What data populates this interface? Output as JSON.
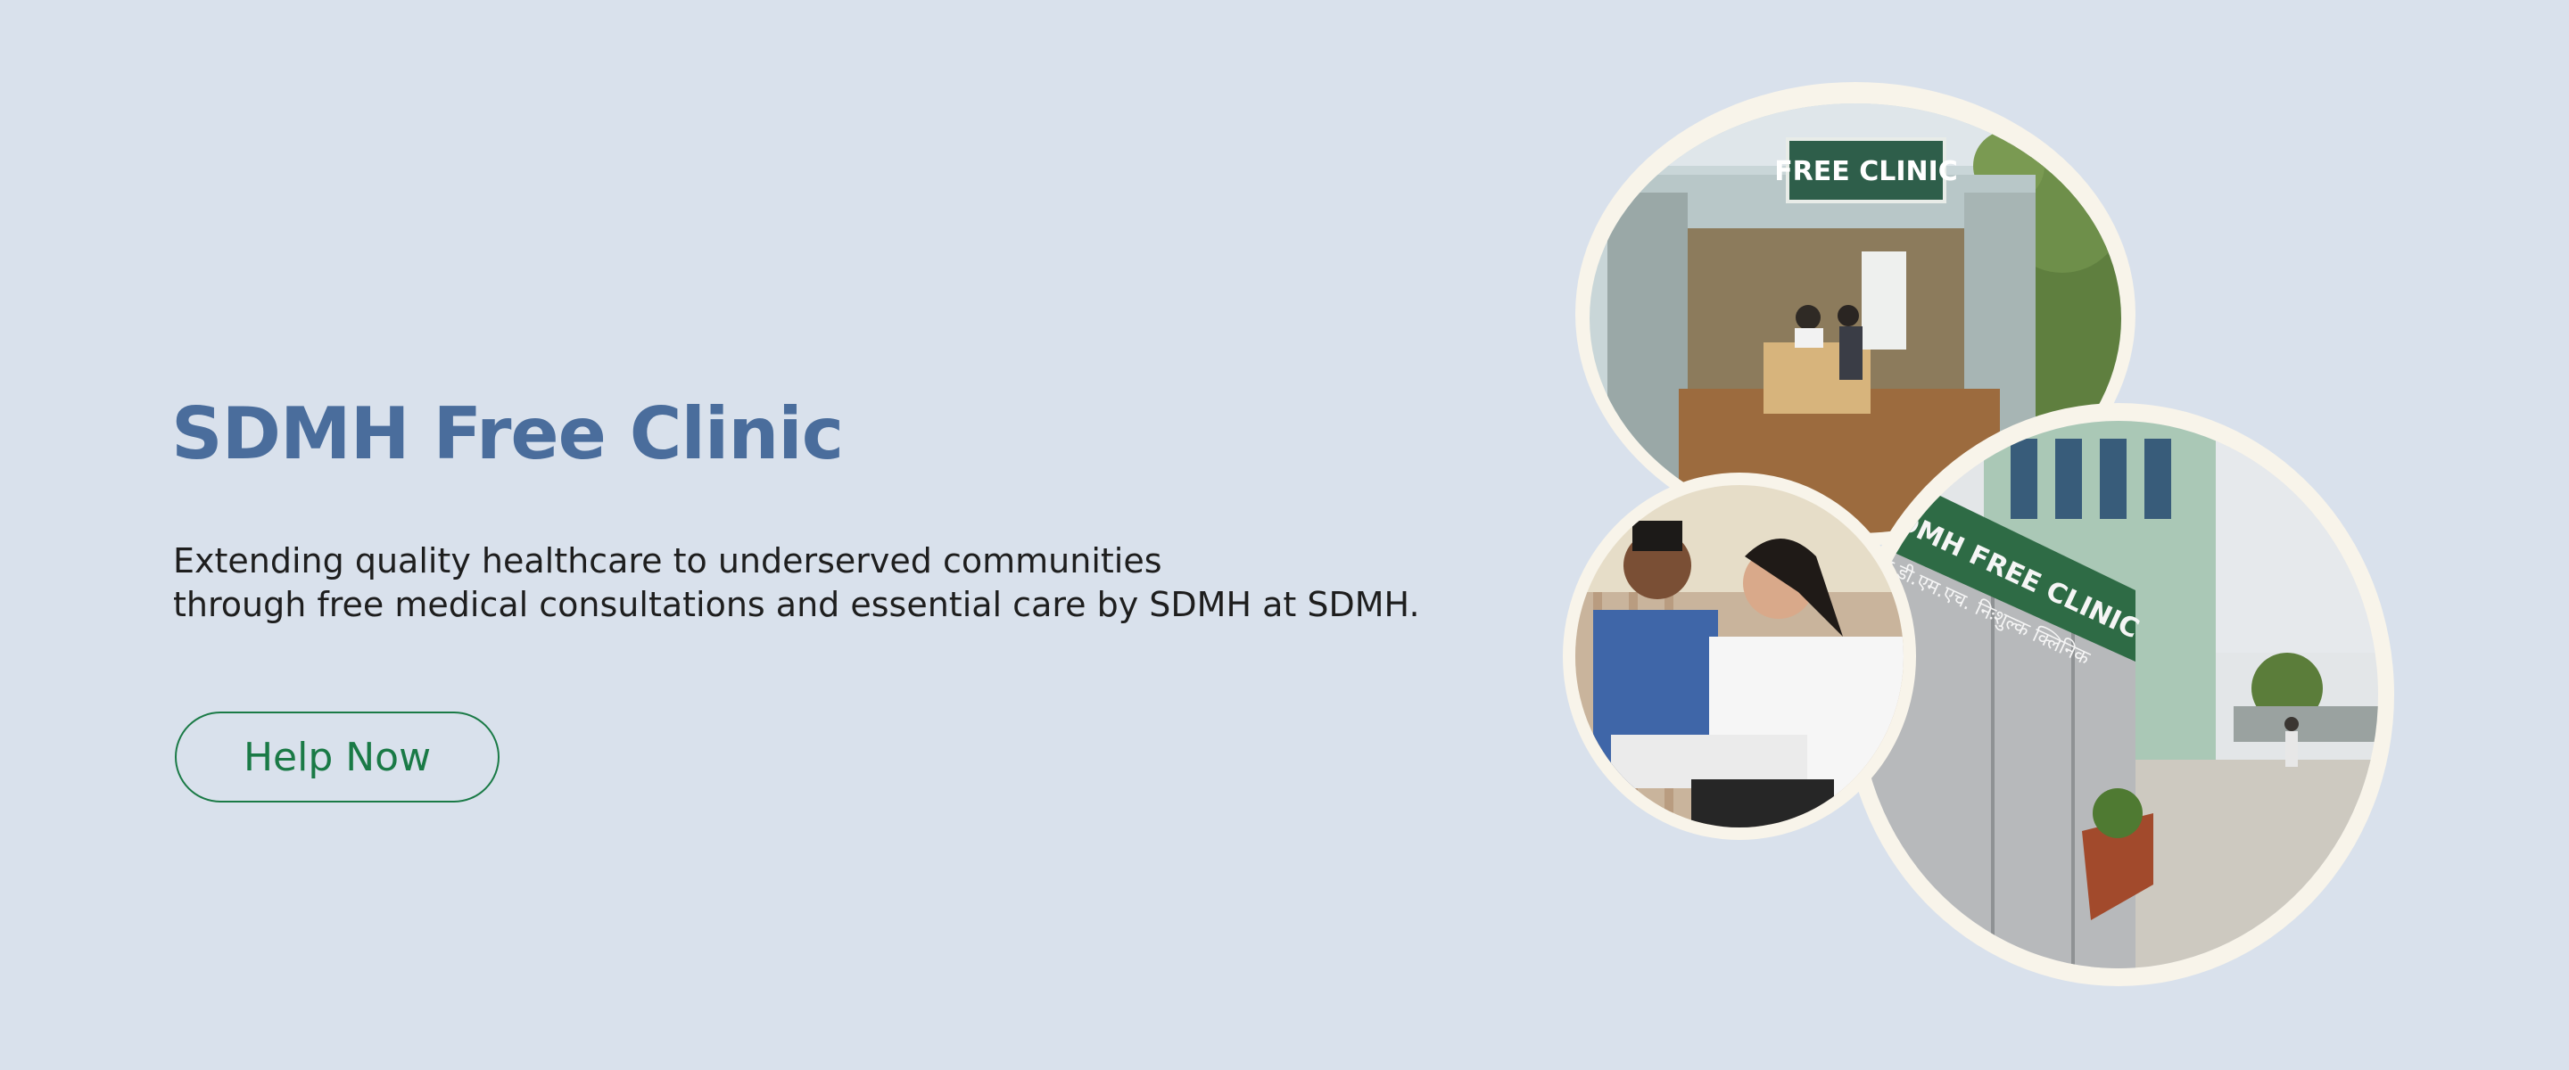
{
  "hero": {
    "title": "SDMH Free Clinic",
    "description_line1": "Extending quality healthcare to underserved communities",
    "description_line2": "through free medical consultations and essential care by SDMH at SDMH.",
    "cta_label": "Help Now"
  },
  "photos": {
    "kiosk_sign": "FREE CLINIC",
    "building_sign_en": "SDMH FREE CLINIC",
    "building_sign_hi": "एस.डी.एम.एच. निःशुल्क क्लिनिक"
  },
  "colors": {
    "background": "#d9e1ec",
    "title": "#4a6d9c",
    "accent_green": "#1a7a46",
    "photo_frame": "#f8f4ea"
  }
}
